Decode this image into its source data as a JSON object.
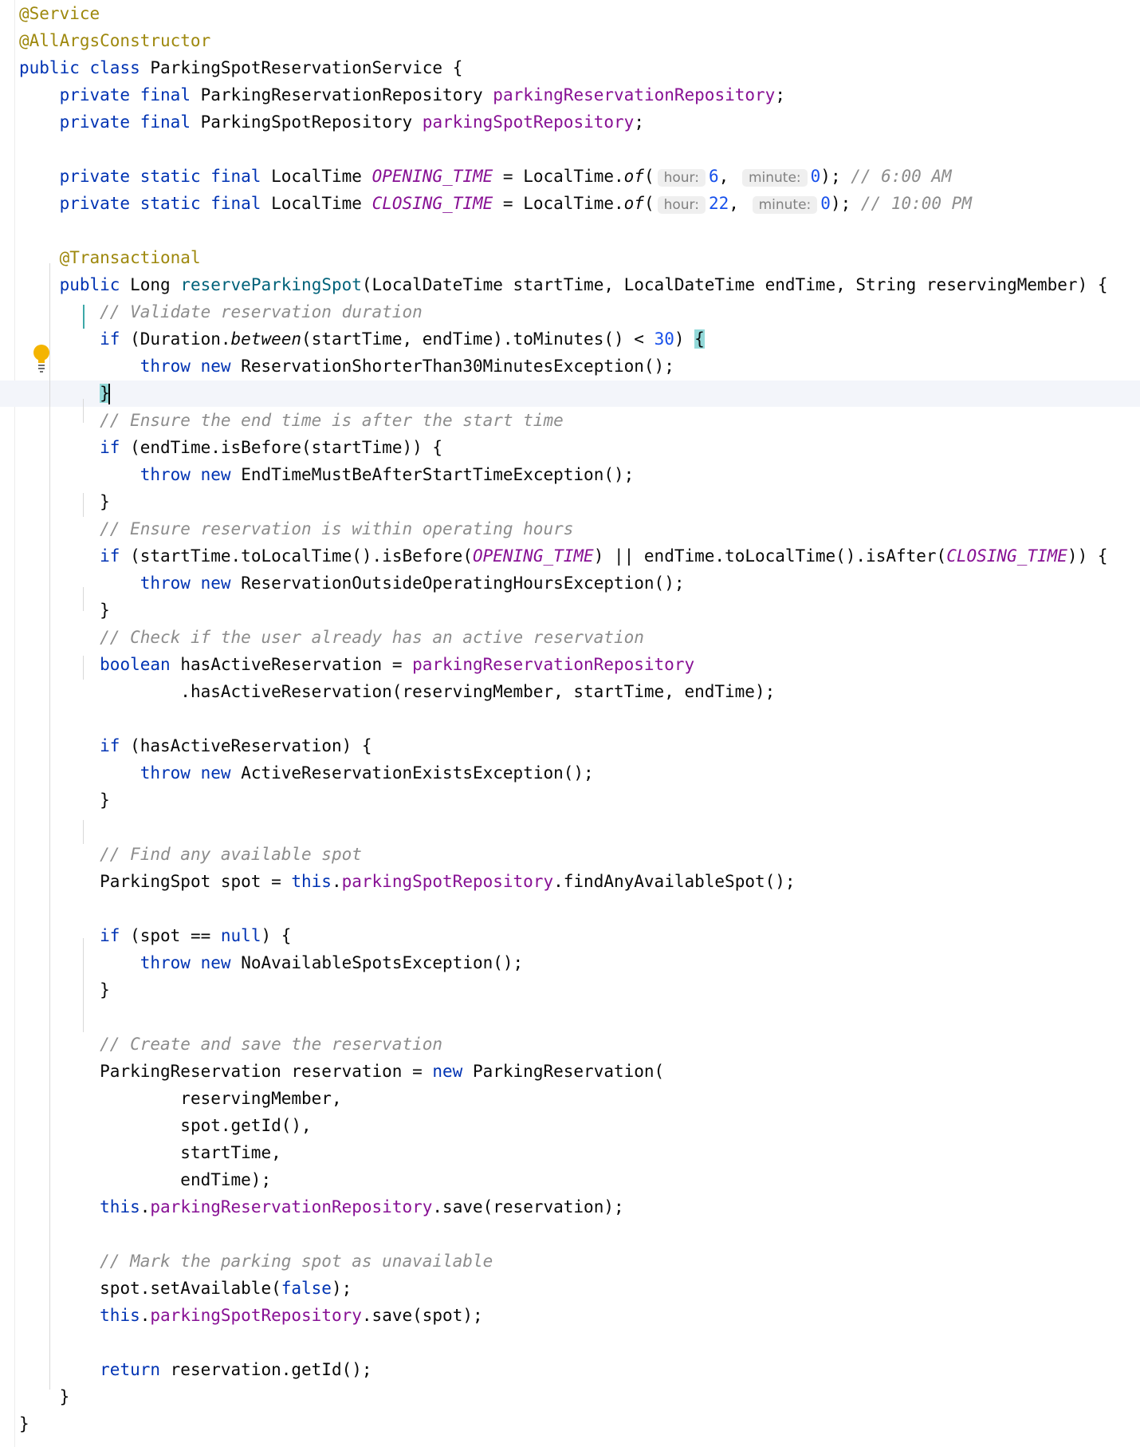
{
  "editor": {
    "language": "java",
    "intention_icon": "lightbulb-icon",
    "lines": {
      "l1": {
        "ann": "@Service"
      },
      "l2": {
        "ann": "@AllArgsConstructor"
      },
      "l3": {
        "kw1": "public",
        "kw2": "class",
        "name": "ParkingSpotReservationService",
        "tail": " {"
      },
      "l4": {
        "kw1": "private",
        "kw2": "final",
        "type": "ParkingReservationRepository",
        "field": "parkingReservationRepository",
        "tail": ";"
      },
      "l5": {
        "kw1": "private",
        "kw2": "final",
        "type": "ParkingSpotRepository",
        "field": "parkingSpotRepository",
        "tail": ";"
      },
      "l6": {
        "kw": "private static final",
        "type": "LocalTime",
        "const": "OPENING_TIME",
        "eq": " = LocalTime.",
        "of": "of",
        "paren": "(",
        "hint1": "hour:",
        "v1": "6",
        "comma": ",",
        "hint2": "minute:",
        "v2": "0",
        "end": ");",
        "comment": "// 6:00 AM"
      },
      "l7": {
        "kw": "private static final",
        "type": "LocalTime",
        "const": "CLOSING_TIME",
        "eq": " = LocalTime.",
        "of": "of",
        "paren": "(",
        "hint1": "hour:",
        "v1": "22",
        "comma": ",",
        "hint2": "minute:",
        "v2": "0",
        "end": ");",
        "comment": "// 10:00 PM"
      },
      "l8": {
        "ann": "@Transactional"
      },
      "l9": {
        "kw": "public",
        "type": "Long",
        "method": "reserveParkingSpot",
        "params": "(LocalDateTime startTime, LocalDateTime endTime, String reservingMember) {"
      },
      "l10": {
        "comment": "// Validate reservation duration"
      },
      "l11": {
        "kw": "if",
        "pre": " (Duration.",
        "between": "between",
        "mid": "(startTime, endTime).toMinutes() < ",
        "num": "30",
        "post": ") ",
        "brace": "{"
      },
      "l12": {
        "kw1": "throw",
        "kw2": "new",
        "rest": "ReservationShorterThan30MinutesException();"
      },
      "l13": {
        "brace": "}"
      },
      "l14": {
        "comment": "// Ensure the end time is after the start time"
      },
      "l15": {
        "kw": "if",
        "rest": " (endTime.isBefore(startTime)) {"
      },
      "l16": {
        "kw1": "throw",
        "kw2": "new",
        "rest": "EndTimeMustBeAfterStartTimeException();"
      },
      "l17": {
        "brace": "}"
      },
      "l18": {
        "comment": "// Ensure reservation is within operating hours"
      },
      "l19": {
        "kw": "if",
        "a": " (startTime.toLocalTime().isBefore(",
        "c1": "OPENING_TIME",
        "b": ") || endTime.toLocalTime().isAfter(",
        "c2": "CLOSING_TIME",
        "c": ")) {"
      },
      "l20": {
        "kw1": "throw",
        "kw2": "new",
        "rest": "ReservationOutsideOperatingHoursException();"
      },
      "l21": {
        "brace": "}"
      },
      "l22": {
        "comment": "// Check if the user already has an active reservation"
      },
      "l23": {
        "kw": "boolean",
        "mid": " hasActiveReservation = ",
        "field": "parkingReservationRepository"
      },
      "l24": {
        "rest": ".hasActiveReservation(reservingMember, startTime, endTime);"
      },
      "l25": {
        "kw": "if",
        "rest": " (hasActiveReservation) {"
      },
      "l26": {
        "kw1": "throw",
        "kw2": "new",
        "rest": "ActiveReservationExistsException();"
      },
      "l27": {
        "brace": "}"
      },
      "l28": {
        "comment": "// Find any available spot"
      },
      "l29": {
        "pre": "ParkingSpot spot = ",
        "this": "this",
        "dot": ".",
        "field": "parkingSpotRepository",
        "rest": ".findAnyAvailableSpot();"
      },
      "l30": {
        "kw": "if",
        "pre": " (spot == ",
        "null": "null",
        "post": ") {"
      },
      "l31": {
        "kw1": "throw",
        "kw2": "new",
        "rest": "NoAvailableSpotsException();"
      },
      "l32": {
        "brace": "}"
      },
      "l33": {
        "comment": "// Create and save the reservation"
      },
      "l34": {
        "pre": "ParkingReservation reservation = ",
        "kw": "new",
        "rest": " ParkingReservation("
      },
      "l35": {
        "rest": "reservingMember,"
      },
      "l36": {
        "rest": "spot.getId(),"
      },
      "l37": {
        "rest": "startTime,"
      },
      "l38": {
        "rest": "endTime);"
      },
      "l39": {
        "this": "this",
        "dot": ".",
        "field": "parkingReservationRepository",
        "rest": ".save(reservation);"
      },
      "l40": {
        "comment": "// Mark the parking spot as unavailable"
      },
      "l41": {
        "pre": "spot.setAvailable(",
        "kw": "false",
        "post": ");"
      },
      "l42": {
        "this": "this",
        "dot": ".",
        "field": "parkingSpotRepository",
        "rest": ".save(spot);"
      },
      "l43": {
        "kw": "return",
        "rest": " reservation.getId();"
      },
      "l44": {
        "brace": "}"
      },
      "l45": {
        "brace": "}"
      }
    }
  }
}
